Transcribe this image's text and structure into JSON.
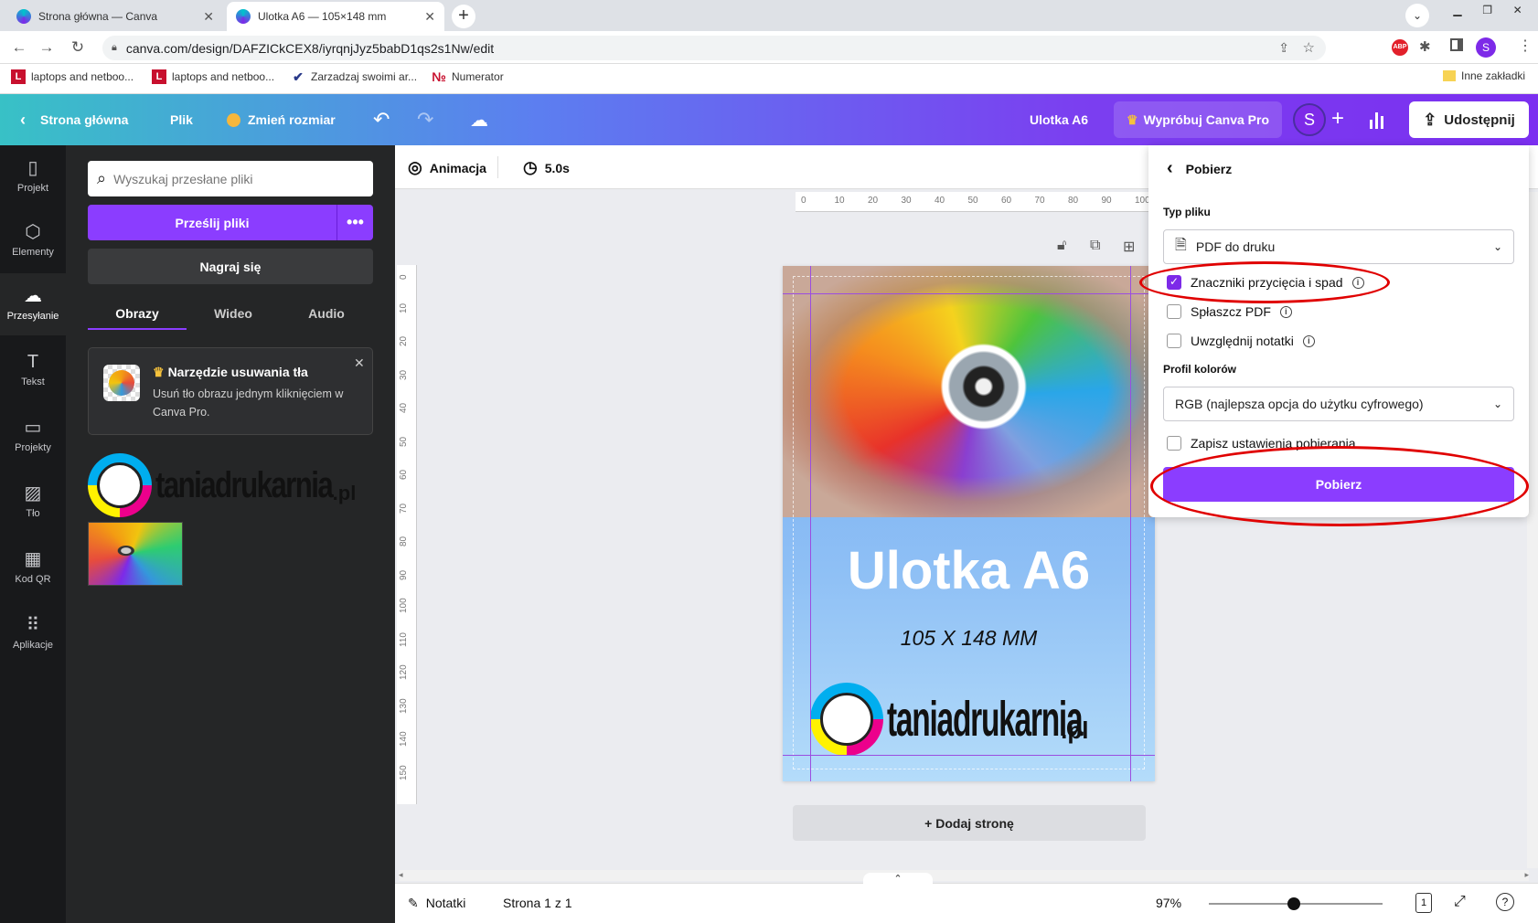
{
  "browser": {
    "tabs": [
      {
        "title": "Strona główna — Canva"
      },
      {
        "title": "Ulotka A6 — 105×148 mm"
      }
    ],
    "url": "canva.com/design/DAFZICkCEX8/iyrqnjJyz5babD1qs2s1Nw/edit",
    "bookmarks": [
      {
        "label": "laptops and netboo..."
      },
      {
        "label": "laptops and netboo..."
      },
      {
        "label": "Zarzadzaj swoimi ar..."
      },
      {
        "label": "Numerator"
      }
    ],
    "other_bookmarks": "Inne zakładki",
    "profile_initial": "S",
    "abp": "ABP"
  },
  "header": {
    "home": "Strona główna",
    "file": "Plik",
    "resize": "Zmień rozmiar",
    "doc_title": "Ulotka A6",
    "try_pro": "Wypróbuj Canva Pro",
    "avatar": "S",
    "share": "Udostępnij"
  },
  "sidenav": [
    {
      "label": "Projekt",
      "icon": "layout-icon"
    },
    {
      "label": "Elementy",
      "icon": "shapes-icon"
    },
    {
      "label": "Przesyłanie",
      "icon": "upload-cloud-icon"
    },
    {
      "label": "Tekst",
      "icon": "text-icon"
    },
    {
      "label": "Projekty",
      "icon": "folder-icon"
    },
    {
      "label": "Tło",
      "icon": "background-icon"
    },
    {
      "label": "Kod QR",
      "icon": "qr-icon"
    },
    {
      "label": "Aplikacje",
      "icon": "apps-icon"
    }
  ],
  "panel": {
    "search_placeholder": "Wyszukaj przesłane pliki",
    "upload_btn": "Prześlij pliki",
    "record_btn": "Nagraj się",
    "tabs": [
      "Obrazy",
      "Wideo",
      "Audio"
    ],
    "promo_title": "Narzędzie usuwania tła",
    "promo_text": "Usuń tło obrazu jednym kliknięciem w Canva Pro."
  },
  "logo": {
    "brand": "taniadrukarnia",
    "suffix": ".pl"
  },
  "toolbar": {
    "animation": "Animacja",
    "duration": "5.0s"
  },
  "ruler": {
    "top": [
      "0",
      "10",
      "20",
      "30",
      "40",
      "50",
      "60",
      "70",
      "80",
      "90",
      "100"
    ],
    "left": [
      "0",
      "10",
      "20",
      "30",
      "40",
      "50",
      "60",
      "70",
      "80",
      "90",
      "100",
      "110",
      "120",
      "130",
      "140",
      "150"
    ]
  },
  "flyer": {
    "title": "Ulotka A6",
    "subtitle": "105 X 148 MM"
  },
  "add_page": "+ Dodaj stronę",
  "download": {
    "title": "Pobierz",
    "file_type_label": "Typ pliku",
    "file_type_value": "PDF do druku",
    "options": [
      {
        "label": "Znaczniki przycięcia i spad",
        "checked": true
      },
      {
        "label": "Spłaszcz PDF",
        "checked": false
      },
      {
        "label": "Uwzględnij notatki",
        "checked": false
      }
    ],
    "color_profile_label": "Profil kolorów",
    "color_profile_value": "RGB (najlepsza opcja do użytku cyfrowego)",
    "save_settings": "Zapisz ustawienia pobierania",
    "button": "Pobierz"
  },
  "bottom": {
    "notes": "Notatki",
    "page": "Strona 1 z 1",
    "zoom": "97%",
    "zoom_fraction": 0.49,
    "page_num": "1",
    "help": "?"
  },
  "colors": {
    "accent": "#7d2ae8",
    "highlight": "#e00000"
  }
}
